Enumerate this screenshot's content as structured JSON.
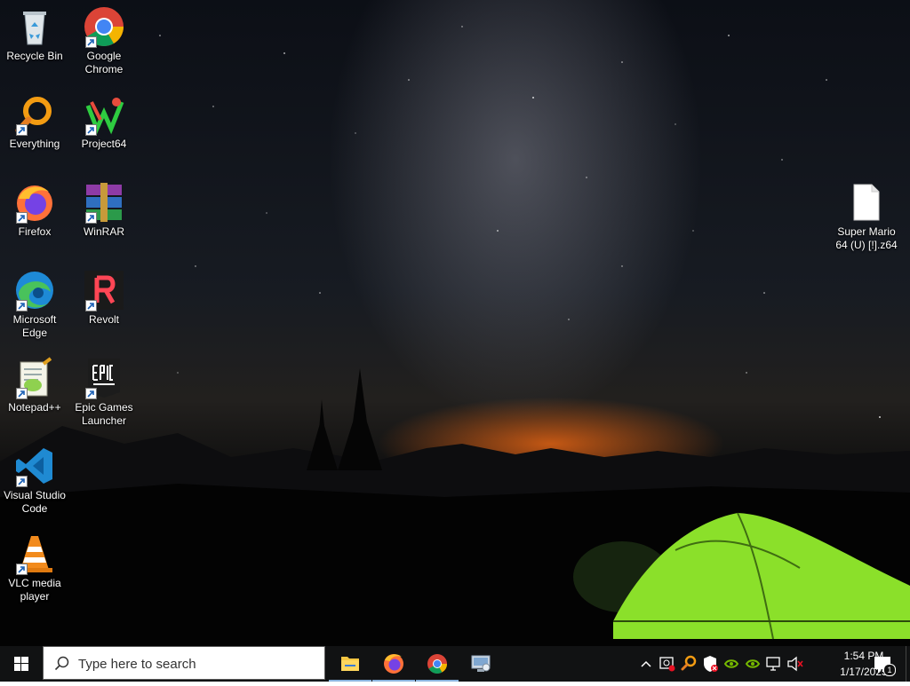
{
  "desktop": {
    "icons": [
      {
        "name": "recycle-bin",
        "label": "Recycle Bin",
        "icon": "recycle-bin-icon"
      },
      {
        "name": "google-chrome",
        "label": "Google Chrome",
        "icon": "chrome-icon"
      },
      {
        "name": "everything",
        "label": "Everything",
        "icon": "everything-icon"
      },
      {
        "name": "project64",
        "label": "Project64",
        "icon": "project64-icon"
      },
      {
        "name": "firefox",
        "label": "Firefox",
        "icon": "firefox-icon"
      },
      {
        "name": "winrar",
        "label": "WinRAR",
        "icon": "winrar-icon"
      },
      {
        "name": "microsoft-edge",
        "label": "Microsoft Edge",
        "icon": "edge-icon"
      },
      {
        "name": "revolt",
        "label": "Revolt",
        "icon": "revolt-icon"
      },
      {
        "name": "notepadpp",
        "label": "Notepad++",
        "icon": "notepadpp-icon"
      },
      {
        "name": "epic-games",
        "label": "Epic Games Launcher",
        "icon": "epic-games-icon"
      },
      {
        "name": "vscode",
        "label": "Visual Studio Code",
        "icon": "vscode-icon"
      },
      {
        "name": "vlc",
        "label": "VLC media player",
        "icon": "vlc-icon"
      },
      {
        "name": "super-mario-file",
        "label": "Super Mario 64 (U) [!].z64",
        "icon": "file-icon"
      }
    ]
  },
  "taskbar": {
    "search_placeholder": "Type here to search",
    "pinned": [
      {
        "name": "file-explorer",
        "icon": "folder-icon"
      },
      {
        "name": "firefox",
        "icon": "firefox-icon"
      },
      {
        "name": "chrome",
        "icon": "chrome-icon"
      },
      {
        "name": "control-panel",
        "icon": "control-panel-icon"
      }
    ],
    "clock": {
      "time": "1:54 PM",
      "date": "1/17/2025"
    },
    "notification_count": "1"
  },
  "colors": {
    "taskbar_bg": "#111213",
    "active_underline": "#8ab4de",
    "tent": "#8be02a"
  }
}
